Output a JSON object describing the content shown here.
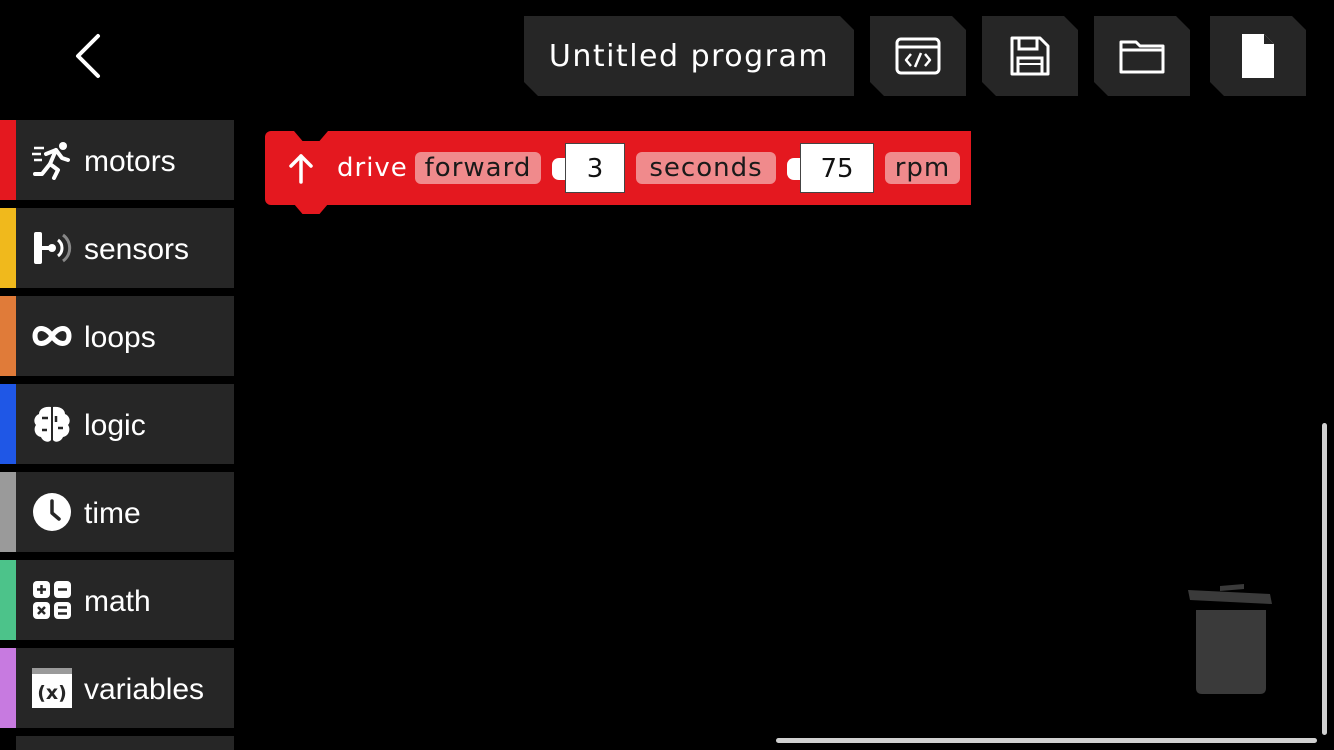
{
  "toolbar": {
    "back_icon": "chevron-left-icon",
    "program_title": "Untitled program",
    "code_icon": "code-view-icon",
    "save_icon": "floppy-disk-icon",
    "open_icon": "folder-icon",
    "new_icon": "new-file-icon"
  },
  "sidebar": {
    "items": [
      {
        "label": "motors",
        "color": "#e4181f",
        "icon": "running-person-icon"
      },
      {
        "label": "sensors",
        "color": "#f0b91c",
        "icon": "sensor-icon"
      },
      {
        "label": "loops",
        "color": "#e07b39",
        "icon": "infinity-icon"
      },
      {
        "label": "logic",
        "color": "#1f57e6",
        "icon": "brain-icon"
      },
      {
        "label": "time",
        "color": "#9a9a9a",
        "icon": "clock-icon"
      },
      {
        "label": "math",
        "color": "#4cc38a",
        "icon": "calculator-icon"
      },
      {
        "label": "variables",
        "color": "#c77ae0",
        "icon": "variable-icon"
      }
    ]
  },
  "block": {
    "color": "#e4181f",
    "icon": "arrow-up-icon",
    "command": "drive",
    "direction": "forward",
    "duration": "3",
    "duration_unit": "seconds",
    "speed": "75",
    "speed_unit": "rpm"
  },
  "workspace": {
    "trash_icon": "trash-can-icon"
  }
}
